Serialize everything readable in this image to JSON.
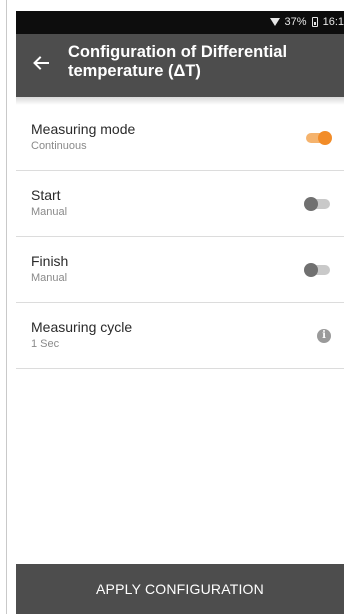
{
  "status_bar": {
    "battery": "37%",
    "time": "16:1",
    "icons": [
      "wifi-icon",
      "battery-icon"
    ]
  },
  "app_bar": {
    "back_icon": "back-arrow-icon",
    "title": "Configuration of Differential temperature (ΔT)"
  },
  "settings": [
    {
      "label": "Measuring mode",
      "value": "Continuous",
      "control": "toggle",
      "state": "on"
    },
    {
      "label": "Start",
      "value": "Manual",
      "control": "toggle",
      "state": "off"
    },
    {
      "label": "Finish",
      "value": "Manual",
      "control": "toggle",
      "state": "off"
    },
    {
      "label": "Measuring cycle",
      "value": "1 Sec",
      "control": "info-icon"
    }
  ],
  "footer": {
    "apply_label": "APPLY CONFIGURATION"
  },
  "colors": {
    "accent": "#f28c28",
    "appbar": "#4d4d4d",
    "statusbar": "#0d0d0d"
  }
}
